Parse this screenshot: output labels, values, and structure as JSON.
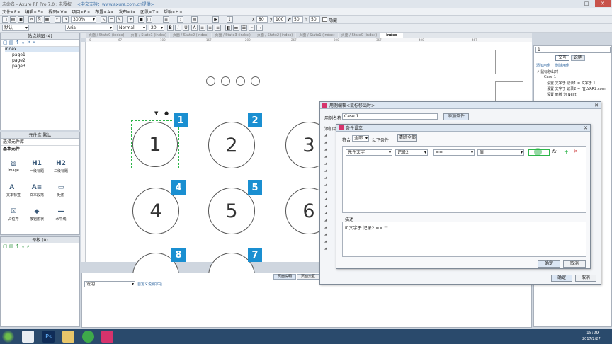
{
  "window": {
    "title": "未命名 - Axure RP Pro 7.0 : 未授权",
    "notice": "<中文支持：www.axure.com.cn提供>"
  },
  "menu": [
    "文件<F>",
    "编辑<E>",
    "视图<V>",
    "项目<P>",
    "布置<A>",
    "发布<I>",
    "团队<T>",
    "帮助<H>"
  ],
  "toolbar": {
    "zoom": "300%",
    "style": "默认",
    "font": "Arial",
    "weight": "Normal",
    "size": "20",
    "x": "80",
    "y": "100",
    "w": "50",
    "h": "50",
    "hide": "隐藏"
  },
  "sitemap": {
    "title": "站点地图 (4)",
    "root": "index",
    "pages": [
      "page1",
      "page2",
      "page3"
    ]
  },
  "library": {
    "title": "元件库 默认",
    "select": "选择元件库",
    "section": "基本元件",
    "items": [
      {
        "icon": "image",
        "label": "Image",
        "glyph": "▨"
      },
      {
        "icon": "h1",
        "label": "一级标题",
        "glyph": "H1"
      },
      {
        "icon": "h2",
        "label": "二级标题",
        "glyph": "H2"
      },
      {
        "icon": "text-label",
        "label": "文本标签",
        "glyph": "A_"
      },
      {
        "icon": "paragraph",
        "label": "文本段落",
        "glyph": "A≡"
      },
      {
        "icon": "rectangle",
        "label": "矩形",
        "glyph": "▭"
      },
      {
        "icon": "placeholder",
        "label": "占位符",
        "glyph": "☒"
      },
      {
        "icon": "shapes",
        "label": "按钮形状",
        "glyph": "◆"
      },
      {
        "icon": "hline",
        "label": "水平线",
        "glyph": "—"
      }
    ]
  },
  "masters": {
    "title": "母板 (0)"
  },
  "tabs": [
    "页面 / State0 (index)",
    "页面 / State1 (index)",
    "页面 / State2 (index)",
    "页面 / State3 (index)",
    "页面 / State2 (index)",
    "页面 / State1 (index)",
    "页面 / State0 (index)",
    "index"
  ],
  "ruler": [
    "0",
    "67",
    "100",
    "167",
    "200",
    "267",
    "300",
    "367",
    "400",
    "467"
  ],
  "circles": [
    {
      "n": "1",
      "badge": "1"
    },
    {
      "n": "2",
      "badge": "2"
    },
    {
      "n": "3",
      "badge": ""
    },
    {
      "n": "4",
      "badge": "4"
    },
    {
      "n": "5",
      "badge": "5"
    },
    {
      "n": "6",
      "badge": ""
    },
    {
      "n": "",
      "badge": "8"
    },
    {
      "n": "",
      "badge": "7"
    }
  ],
  "bottom": {
    "tab1": "页面说明",
    "tab2": "页面交互",
    "select": "说明",
    "link": "自定义说明字段"
  },
  "interaction": {
    "value": "1",
    "tab1": "交互",
    "tab2": "说明",
    "add": "添加用例",
    "remove": "删除用例",
    "event": "鼠标移出时",
    "case": "Case 1",
    "actions": [
      "设置 文字于 记录1 = 文字于 1",
      "设置 文字于 记录2 = \"[[LVAR2.com",
      "设置 面板 为 Next"
    ]
  },
  "caseEditor": {
    "title": "用例编辑<鼠标移出时>",
    "nameLabel": "用例名称",
    "name": "Case 1",
    "addCond": "添加条件",
    "addAction": "添加动作",
    "ok": "确定",
    "cancel": "取消"
  },
  "condDlg": {
    "title": "条件设立",
    "matchLabel": "符合",
    "match": "全部",
    "matchSuffix": "以下条件",
    "clear": "清除全部",
    "c1": "元件文字",
    "c2": "记录2",
    "c3": "==",
    "c4": "值",
    "descLabel": "描述",
    "desc": "if 文字于 记录2 == \"\"",
    "ok": "确定",
    "cancel": "取消"
  },
  "clock": {
    "time": "15:29",
    "date": "2017/2/27"
  }
}
